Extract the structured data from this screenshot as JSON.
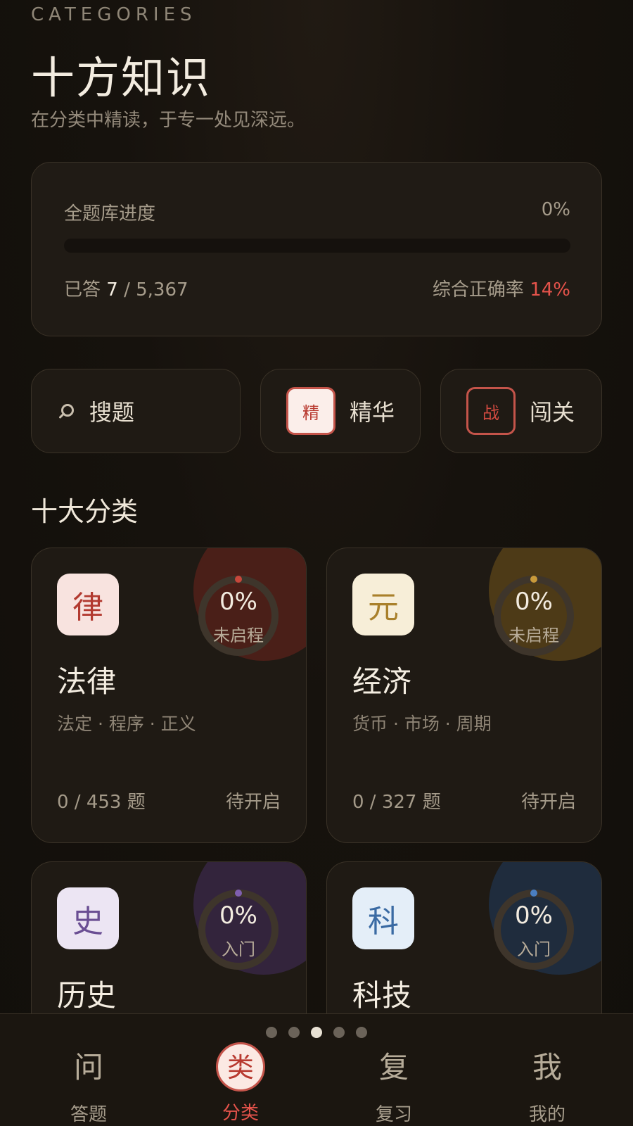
{
  "header": {
    "eyebrow": "CATEGORIES",
    "title": "十方知识",
    "subtitle": "在分类中精读，于专一处见深远。"
  },
  "progress": {
    "label": "全题库进度",
    "percent": "0%",
    "fill_fraction": 0.0,
    "answered_prefix": "已答",
    "answered": "7",
    "total": "/ 5,367",
    "accuracy_label": "综合正确率",
    "accuracy": "14%"
  },
  "quick_actions": {
    "search_label": "搜题",
    "elite_seal": "精",
    "elite_label": "精华",
    "battle_seal": "战",
    "battle_label": "闯关"
  },
  "section_title": "十大分类",
  "categories": [
    {
      "badge": "律",
      "name": "法律",
      "pct": "0%",
      "status": "未启程",
      "tags": "法定 · 程序 · 正义",
      "count": "0 / 453 题",
      "state": "待开启",
      "accent": "#c8473b",
      "blob": "#4a1f18",
      "badge_bg": "#f8e3df",
      "badge_fg": "#b23a30"
    },
    {
      "badge": "元",
      "name": "经济",
      "pct": "0%",
      "status": "未启程",
      "tags": "货币 · 市场 · 周期",
      "count": "0 / 327 题",
      "state": "待开启",
      "accent": "#c99a3a",
      "blob": "#4d3a17",
      "badge_bg": "#f7eed8",
      "badge_fg": "#a9802b"
    },
    {
      "badge": "史",
      "name": "历史",
      "pct": "0%",
      "status": "入门",
      "accent": "#7f5fae",
      "blob": "#33243c",
      "badge_bg": "#ece5f3",
      "badge_fg": "#6a4e93"
    },
    {
      "badge": "科",
      "name": "科技",
      "pct": "0%",
      "status": "入门",
      "accent": "#4a7ec0",
      "blob": "#1f2c3d",
      "badge_bg": "#e4eef8",
      "badge_fg": "#3a6aa3"
    }
  ],
  "pager": {
    "count": 5,
    "active_index": 2
  },
  "nav": [
    {
      "glyph": "问",
      "label": "答题",
      "active": false
    },
    {
      "glyph": "类",
      "label": "分类",
      "active": true
    },
    {
      "glyph": "复",
      "label": "复习",
      "active": false
    },
    {
      "glyph": "我",
      "label": "我的",
      "active": false
    }
  ]
}
